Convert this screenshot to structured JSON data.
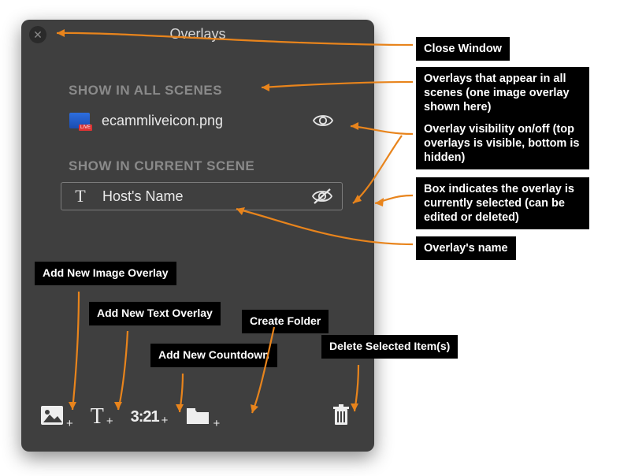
{
  "panel": {
    "title": "Overlays",
    "sections": {
      "all": "SHOW IN ALL SCENES",
      "current": "SHOW IN CURRENT SCENE"
    },
    "items": [
      {
        "name": "ecammliveicon.png"
      },
      {
        "name": "Host's Name"
      }
    ],
    "toolbar": {
      "countdown_label": "3:21"
    }
  },
  "annotations": {
    "close": "Close Window",
    "all_scenes": "Overlays that appear in all scenes (one image overlay shown here)",
    "visibility": "Overlay visibility on/off (top overlays is visible, bottom is hidden)",
    "selected": "Box indicates the overlay is currently selected (can be edited or deleted)",
    "overlay_name": "Overlay's name",
    "add_image": "Add New Image Overlay",
    "add_text": "Add New Text Overlay",
    "add_countdown": "Add New Countdown",
    "create_folder": "Create Folder",
    "delete": "Delete Selected Item(s)"
  }
}
